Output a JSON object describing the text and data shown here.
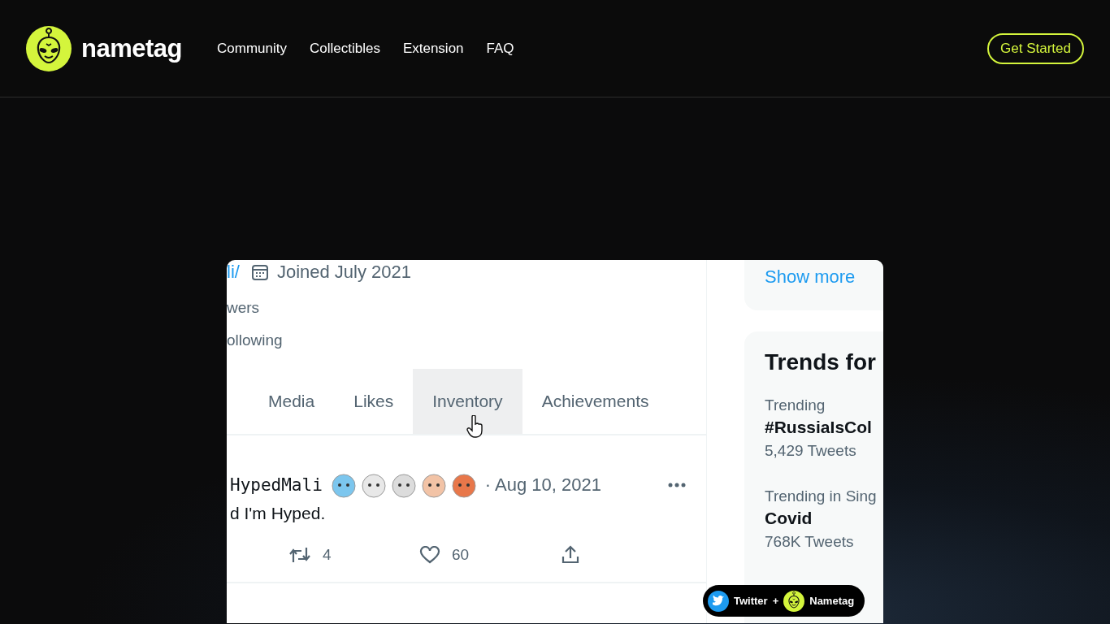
{
  "header": {
    "logo_text": "nametag",
    "nav": [
      "Community",
      "Collectibles",
      "Extension",
      "FAQ"
    ],
    "cta": "Get Started"
  },
  "preview": {
    "profile": {
      "link_fragment": "li/",
      "joined": "Joined July 2021",
      "followers_fragment": "wers",
      "following_fragment": "ollowing"
    },
    "tabs": [
      {
        "label": "Media",
        "hovered": false
      },
      {
        "label": "Likes",
        "hovered": false
      },
      {
        "label": "Inventory",
        "hovered": true
      },
      {
        "label": "Achievements",
        "hovered": false
      }
    ],
    "tweet": {
      "name": "HypedMali",
      "date": "· Aug 10, 2021",
      "text": "d I'm Hyped.",
      "retweets": "4",
      "likes": "60"
    },
    "sidebar": {
      "show_more": "Show more",
      "trends_title": "Trends for",
      "trends": [
        {
          "context": "Trending",
          "topic": "#RussiaIsCol",
          "count": "5,429 Tweets"
        },
        {
          "context": "Trending in Sing",
          "topic": "Covid",
          "count": "768K Tweets"
        }
      ]
    }
  },
  "badge": {
    "left": "Twitter",
    "plus": "+",
    "right": "Nametag"
  }
}
